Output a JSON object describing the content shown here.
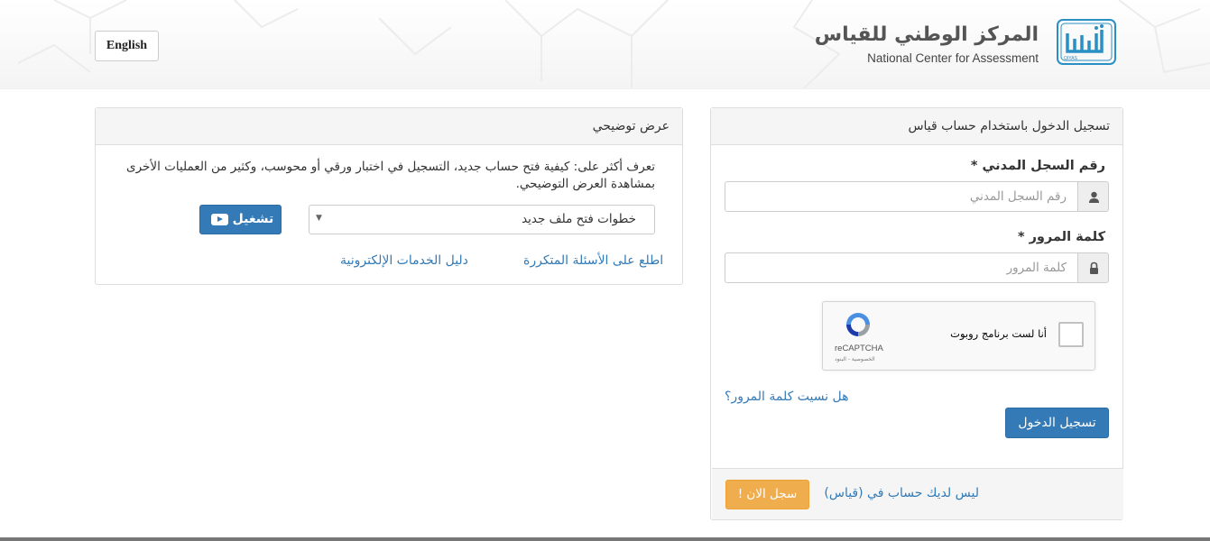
{
  "header": {
    "lang_button": "English",
    "logo_title": "المركز الوطني للقياس",
    "logo_subtitle": "National Center for Assessment",
    "logo_mark_text": "قياس",
    "logo_mark_small": "QIYAS"
  },
  "demo_panel": {
    "title": "عرض توضيحي",
    "description": "تعرف أكثر على: كيفية فتح حساب جديد، التسجيل في اختبار ورقي أو محوسب، وكثير من العمليات الأخرى بمشاهدة العرض التوضيحي.",
    "select_value": "خطوات فتح ملف جديد",
    "play_button": "تشغيل",
    "faq_link": "اطلع على الأسئلة المتكررة",
    "guide_link": "دليل الخدمات الإلكترونية"
  },
  "login_panel": {
    "title": "تسجيل الدخول باستخدام حساب قياس",
    "civil_label": "رقم السجل المدني *",
    "civil_placeholder": "رقم السجل المدني",
    "password_label": "كلمة المرور *",
    "password_placeholder": "كلمة المرور",
    "captcha_label": "أنا لست برنامج روبوت",
    "captcha_brand": "reCAPTCHA",
    "captcha_terms": "الخصوصية - البنود",
    "forgot_link": "هل نسيت كلمة المرور؟",
    "submit_button": "تسجيل الدخول",
    "no_account": "ليس لديك حساب في (قياس)",
    "register_button": "سجل الان !"
  },
  "colors": {
    "primary": "#337ab7",
    "warning": "#f0ad4e",
    "logo_blue": "#2a8fc4"
  }
}
